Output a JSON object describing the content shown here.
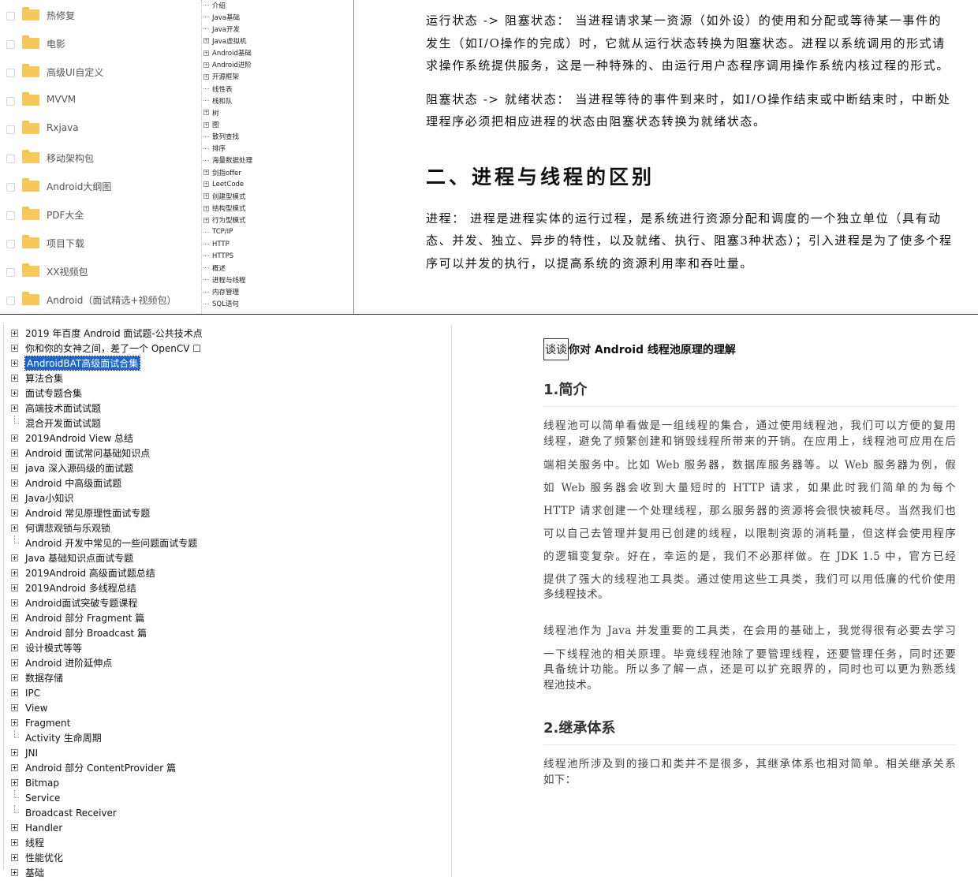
{
  "folders": [
    "热修复",
    "电影",
    "高级UI自定义",
    "MVVM",
    "Rxjava",
    "移动架构包",
    "Android大纲图",
    "PDF大全",
    "项目下载",
    "XX视频包",
    "Android（面试精选+视频包）"
  ],
  "mini_tree": [
    {
      "label": "介绍",
      "exp": false
    },
    {
      "label": "Java基础",
      "exp": false
    },
    {
      "label": "Java开发",
      "exp": false
    },
    {
      "label": "Java虚拟机",
      "exp": true
    },
    {
      "label": "Android基础",
      "exp": true
    },
    {
      "label": "Android进阶",
      "exp": true
    },
    {
      "label": "开源框架",
      "exp": true
    },
    {
      "label": "线性表",
      "exp": false
    },
    {
      "label": "栈和队",
      "exp": false
    },
    {
      "label": "树",
      "exp": true
    },
    {
      "label": "图",
      "exp": true
    },
    {
      "label": "散列查找",
      "exp": false
    },
    {
      "label": "排序",
      "exp": false
    },
    {
      "label": "海量数据处理",
      "exp": false
    },
    {
      "label": "剑指offer",
      "exp": true
    },
    {
      "label": "LeetCode",
      "exp": true
    },
    {
      "label": "创建型模式",
      "exp": true
    },
    {
      "label": "结构型模式",
      "exp": true
    },
    {
      "label": "行为型模式",
      "exp": true
    },
    {
      "label": "TCP/IP",
      "exp": false
    },
    {
      "label": "HTTP",
      "exp": false
    },
    {
      "label": "HTTPS",
      "exp": false
    },
    {
      "label": "概述",
      "exp": false
    },
    {
      "label": "进程与线程",
      "exp": false
    },
    {
      "label": "内存管理",
      "exp": false
    },
    {
      "label": "SQL语句",
      "exp": false
    }
  ],
  "top_doc": {
    "para1": "运行状态 -> 阻塞状态： 当进程请求某一资源（如外设）的使用和分配或等待某一事件的发生（如I/O操作的完成）时，它就从运行状态转换为阻塞状态。进程以系统调用的形式请求操作系统提供服务，这是一种特殊的、由运行用户态程序调用操作系统内核过程的形式。",
    "para2": "阻塞状态 -> 就绪状态： 当进程等待的事件到来时，如I/O操作结束或中断结束时，中断处理程序必须把相应进程的状态由阻塞状态转换为就绪状态。",
    "heading": "二、进程与线程的区别",
    "para3": "进程： 进程是进程实体的运行过程，是系统进行资源分配和调度的一个独立单位（具有动态、并发、独立、异步的特性，以及就绪、执行、阻塞3种状态）；引入进程是为了使多个程序可以并发的执行，以提高系统的资源利用率和吞吐量。"
  },
  "topic_tree": [
    {
      "label": "2019 年百度 Android 面试题-公共技术点",
      "exp": true
    },
    {
      "label": "你和你的女神之间，差了一个 OpenCV ☐",
      "exp": true
    },
    {
      "label": "AndroidBAT高级面试合集",
      "exp": true,
      "selected": true
    },
    {
      "label": "算法合集",
      "exp": true
    },
    {
      "label": "面试专题合集",
      "exp": true
    },
    {
      "label": "高端技术面试试题",
      "exp": true
    },
    {
      "label": "混合开发面试试题",
      "exp": false
    },
    {
      "label": "2019Android View 总结",
      "exp": true
    },
    {
      "label": "Android 面试常问基础知识点",
      "exp": true
    },
    {
      "label": "java 深入源码级的面试题",
      "exp": true
    },
    {
      "label": "Android 中高级面试题",
      "exp": true
    },
    {
      "label": "Java小知识",
      "exp": true
    },
    {
      "label": "Android 常见原理性面试专题",
      "exp": true
    },
    {
      "label": "何谓悲观锁与乐观锁",
      "exp": true
    },
    {
      "label": "Android 开发中常见的一些问题面试专题",
      "exp": false
    },
    {
      "label": "Java 基础知识点面试专题",
      "exp": true
    },
    {
      "label": "2019Android 高级面试题总结",
      "exp": true
    },
    {
      "label": "2019Android 多线程总结",
      "exp": true
    },
    {
      "label": "Android面试突破专题课程",
      "exp": true
    },
    {
      "label": "Android 部分 Fragment 篇",
      "exp": true
    },
    {
      "label": "Android 部分 Broadcast 篇",
      "exp": true
    },
    {
      "label": "设计模式等等",
      "exp": true
    },
    {
      "label": "Android 进阶延伸点",
      "exp": true
    },
    {
      "label": "数据存储",
      "exp": true
    },
    {
      "label": "IPC",
      "exp": true
    },
    {
      "label": "View",
      "exp": true
    },
    {
      "label": "Fragment",
      "exp": true
    },
    {
      "label": "Activity 生命周期",
      "exp": false
    },
    {
      "label": "JNI",
      "exp": true
    },
    {
      "label": "Android 部分 ContentProvider 篇",
      "exp": true
    },
    {
      "label": "Bitmap",
      "exp": true
    },
    {
      "label": "Service",
      "exp": false
    },
    {
      "label": "Broadcast Receiver",
      "exp": false
    },
    {
      "label": "Handler",
      "exp": true
    },
    {
      "label": "线程",
      "exp": true
    },
    {
      "label": "性能优化",
      "exp": true
    },
    {
      "label": "基础",
      "exp": true
    }
  ],
  "article": {
    "title_boxed": "谈谈",
    "title_rest": "你对 Android 线程池原理的理解",
    "h1": "1.简介",
    "p1_lines": [
      "线程池可以简单看做是一组线程的集合，通过使用线程池，我们可以方便的复用",
      "线程，避免了频繁创建和销毁线程所带来的开销。在应用上，线程池可应用在后",
      "端相关服务中。比如 Web 服务器，数据库服务器等。以 Web 服务器为例，假",
      "如 Web 服务器会收到大量短时的 HTTP 请求，如果此时我们简单的为每个",
      "HTTP 请求创建一个处理线程，那么服务器的资源将会很快被耗尽。当然我们也",
      "可以自己去管理并复用已创建的线程，以限制资源的消耗量，但这样会使用程序",
      "的逻辑变复杂。好在，幸运的是，我们不必那样做。在 JDK 1.5 中，官方已经",
      "提供了强大的线程池工具类。通过使用这些工具类，我们可以用低廉的代价使用",
      "多线程技术。"
    ],
    "p2_lines": [
      "线程池作为 Java 并发重要的工具类，在会用的基础上，我觉得很有必要去学习",
      "一下线程池的相关原理。毕竟线程池除了要管理线程，还要管理任务，同时还要",
      "具备统计功能。所以多了解一点，还是可以扩充眼界的，同时也可以更为熟悉线",
      "程池技术。"
    ],
    "h2": "2.继承体系",
    "p3_lines": [
      "线程池所涉及到的接口和类并不是很多，其继承体系也相对简单。相关继承关系",
      "如下："
    ]
  },
  "icons": {
    "folder": "folder-icon",
    "expand": "tree-expand-icon",
    "checkbox": "checkbox-icon"
  },
  "colors": {
    "folder": "#f7c95c",
    "selection": "#1c66cc"
  }
}
